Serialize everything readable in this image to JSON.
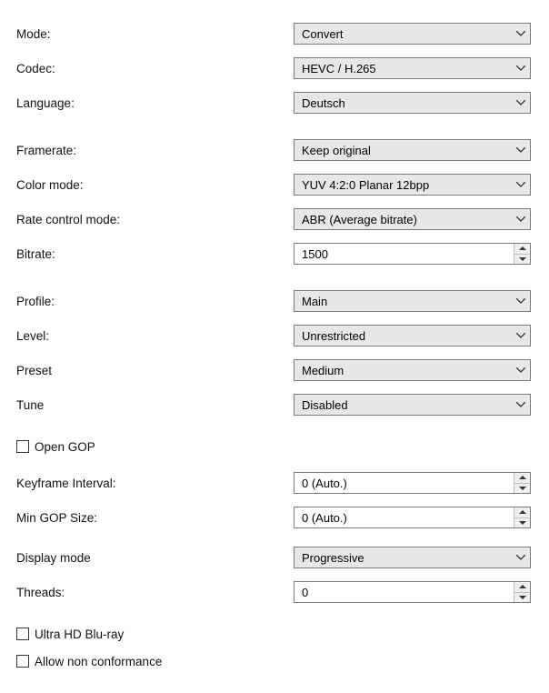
{
  "labels": {
    "mode": "Mode:",
    "codec": "Codec:",
    "language": "Language:",
    "framerate": "Framerate:",
    "colormode": "Color mode:",
    "ratecontrol": "Rate control mode:",
    "bitrate": "Bitrate:",
    "profile": "Profile:",
    "level": "Level:",
    "preset": "Preset",
    "tune": "Tune",
    "opengop": "Open GOP",
    "keyframe": "Keyframe Interval:",
    "mingop": "Min GOP Size:",
    "displaymode": "Display mode",
    "threads": "Threads:",
    "uhdbluray": "Ultra HD Blu-ray",
    "nonconf": "Allow non conformance"
  },
  "values": {
    "mode": "Convert",
    "codec": "HEVC / H.265",
    "language": "Deutsch",
    "framerate": "Keep original",
    "colormode": "YUV 4:2:0 Planar 12bpp",
    "ratecontrol": "ABR (Average bitrate)",
    "bitrate": "1500",
    "profile": "Main",
    "level": "Unrestricted",
    "preset": "Medium",
    "tune": "Disabled",
    "keyframe": "0 (Auto.)",
    "mingop": "0 (Auto.)",
    "displaymode": "Progressive",
    "threads": "0"
  }
}
